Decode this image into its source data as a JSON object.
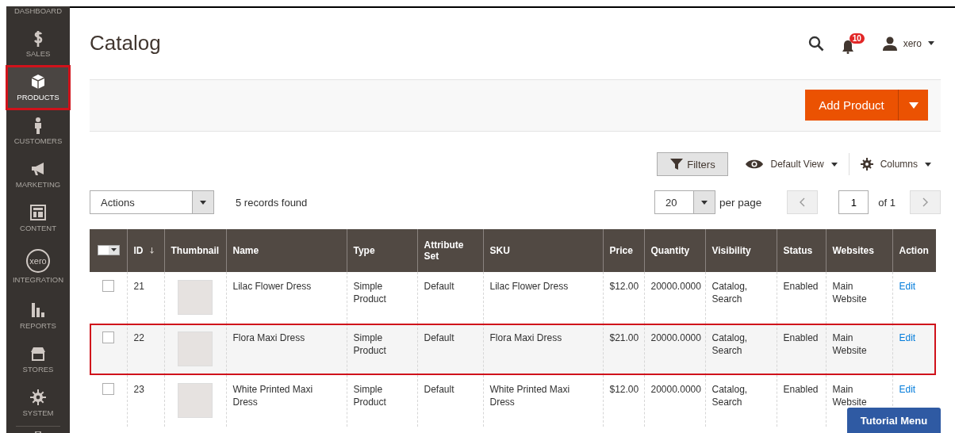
{
  "sidebar": {
    "items": [
      {
        "label": "DASHBOARD",
        "selected": false,
        "highlighted": false
      },
      {
        "label": "SALES",
        "selected": false,
        "highlighted": false
      },
      {
        "label": "PRODUCTS",
        "selected": true,
        "highlighted": true
      },
      {
        "label": "CUSTOMERS",
        "selected": false,
        "highlighted": false
      },
      {
        "label": "MARKETING",
        "selected": false,
        "highlighted": false
      },
      {
        "label": "CONTENT",
        "selected": false,
        "highlighted": false
      },
      {
        "label": "INTEGRATION",
        "selected": false,
        "highlighted": false,
        "logo_text": "xero"
      },
      {
        "label": "REPORTS",
        "selected": false,
        "highlighted": false
      },
      {
        "label": "STORES",
        "selected": false,
        "highlighted": false
      },
      {
        "label": "SYSTEM",
        "selected": false,
        "highlighted": false
      }
    ]
  },
  "page_title": "Catalog",
  "header": {
    "notifications_count": "10",
    "user": "xero"
  },
  "add_button": "Add Product",
  "toolbar": {
    "filters": "Filters",
    "view": "Default View",
    "columns": "Columns"
  },
  "actions_select": "Actions",
  "records_found": "5 records found",
  "per_page": {
    "value": "20",
    "label": "per page"
  },
  "pager": {
    "page": "1",
    "of": "of 1"
  },
  "table": {
    "select_all_checked": false,
    "columns": [
      "ID",
      "Thumbnail",
      "Name",
      "Type",
      "Attribute Set",
      "SKU",
      "Price",
      "Quantity",
      "Visibility",
      "Status",
      "Websites",
      "Action"
    ],
    "rows": [
      {
        "checked": false,
        "highlighted": false,
        "id": "21",
        "name": "Lilac Flower Dress",
        "type": "Simple Product",
        "attribute_set": "Default",
        "sku": "Lilac Flower Dress",
        "price": "$12.00",
        "quantity": "20000.0000",
        "visibility": "Catalog, Search",
        "status": "Enabled",
        "websites": "Main Website",
        "action": "Edit"
      },
      {
        "checked": false,
        "highlighted": true,
        "id": "22",
        "name": "Flora Maxi Dress",
        "type": "Simple Product",
        "attribute_set": "Default",
        "sku": "Flora Maxi Dress",
        "price": "$21.00",
        "quantity": "20000.0000",
        "visibility": "Catalog, Search",
        "status": "Enabled",
        "websites": "Main Website",
        "action": "Edit"
      },
      {
        "checked": false,
        "highlighted": false,
        "id": "23",
        "name": "White Printed Maxi Dress",
        "type": "Simple Product",
        "attribute_set": "Default",
        "sku": "White Printed Maxi Dress",
        "price": "$12.00",
        "quantity": "20000.0000",
        "visibility": "Catalog, Search",
        "status": "Enabled",
        "websites": "Main Website",
        "action": "Edit"
      }
    ]
  },
  "tutorial_button": "Tutorial Menu"
}
